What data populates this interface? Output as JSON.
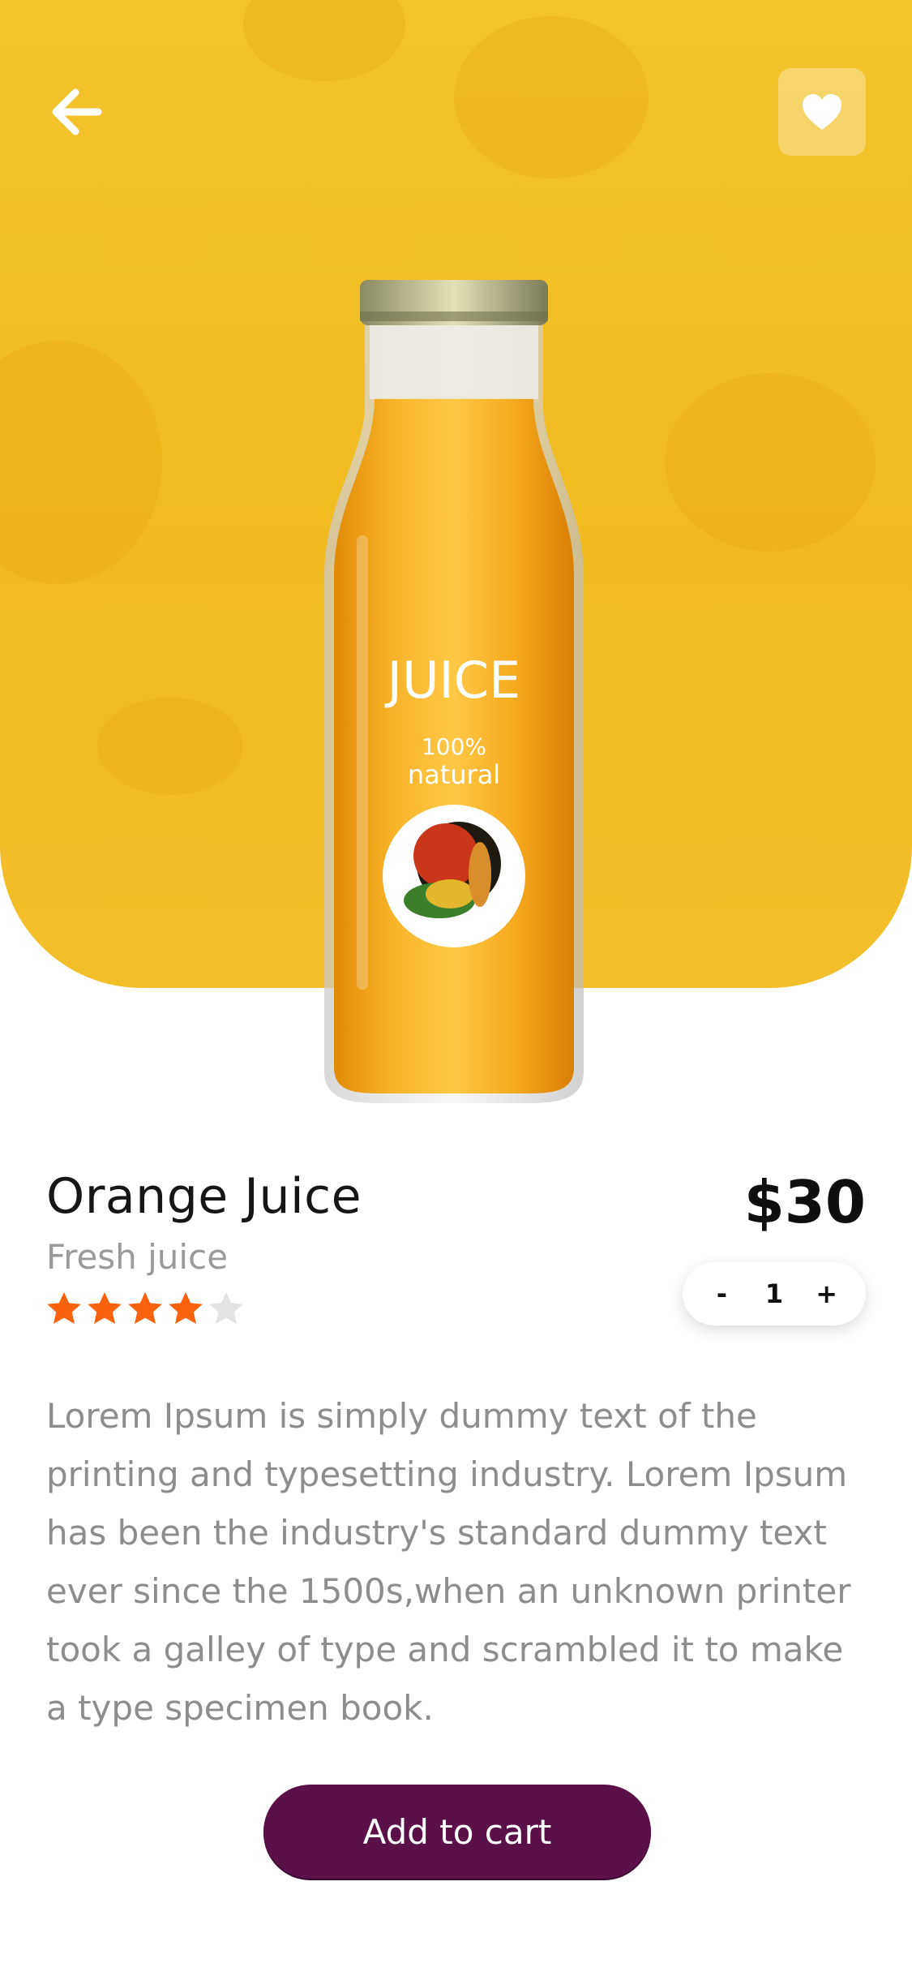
{
  "header": {
    "back_icon": "arrow-left-icon",
    "favorite_icon": "heart-icon"
  },
  "product_image": {
    "label_title": "JUICE",
    "label_line1": "100%",
    "label_line2": "natural"
  },
  "product": {
    "name": "Orange Juice",
    "subtitle": "Fresh juice",
    "price": "$30",
    "rating": 4,
    "rating_max": 5,
    "quantity": "1",
    "minus_label": "-",
    "plus_label": "+",
    "description": "Lorem Ipsum is simply dummy text of the printing and typesetting industry. Lorem Ipsum has been the industry's standard dummy text ever since the 1500s,when an unknown printer took a galley of type and scrambled it to make a type specimen book."
  },
  "actions": {
    "add_to_cart_label": "Add to cart"
  },
  "colors": {
    "hero_yellow": "#f2bf27",
    "star_active": "#f9620d",
    "star_inactive": "#e3e3e3",
    "button_purple": "#5b1048"
  }
}
